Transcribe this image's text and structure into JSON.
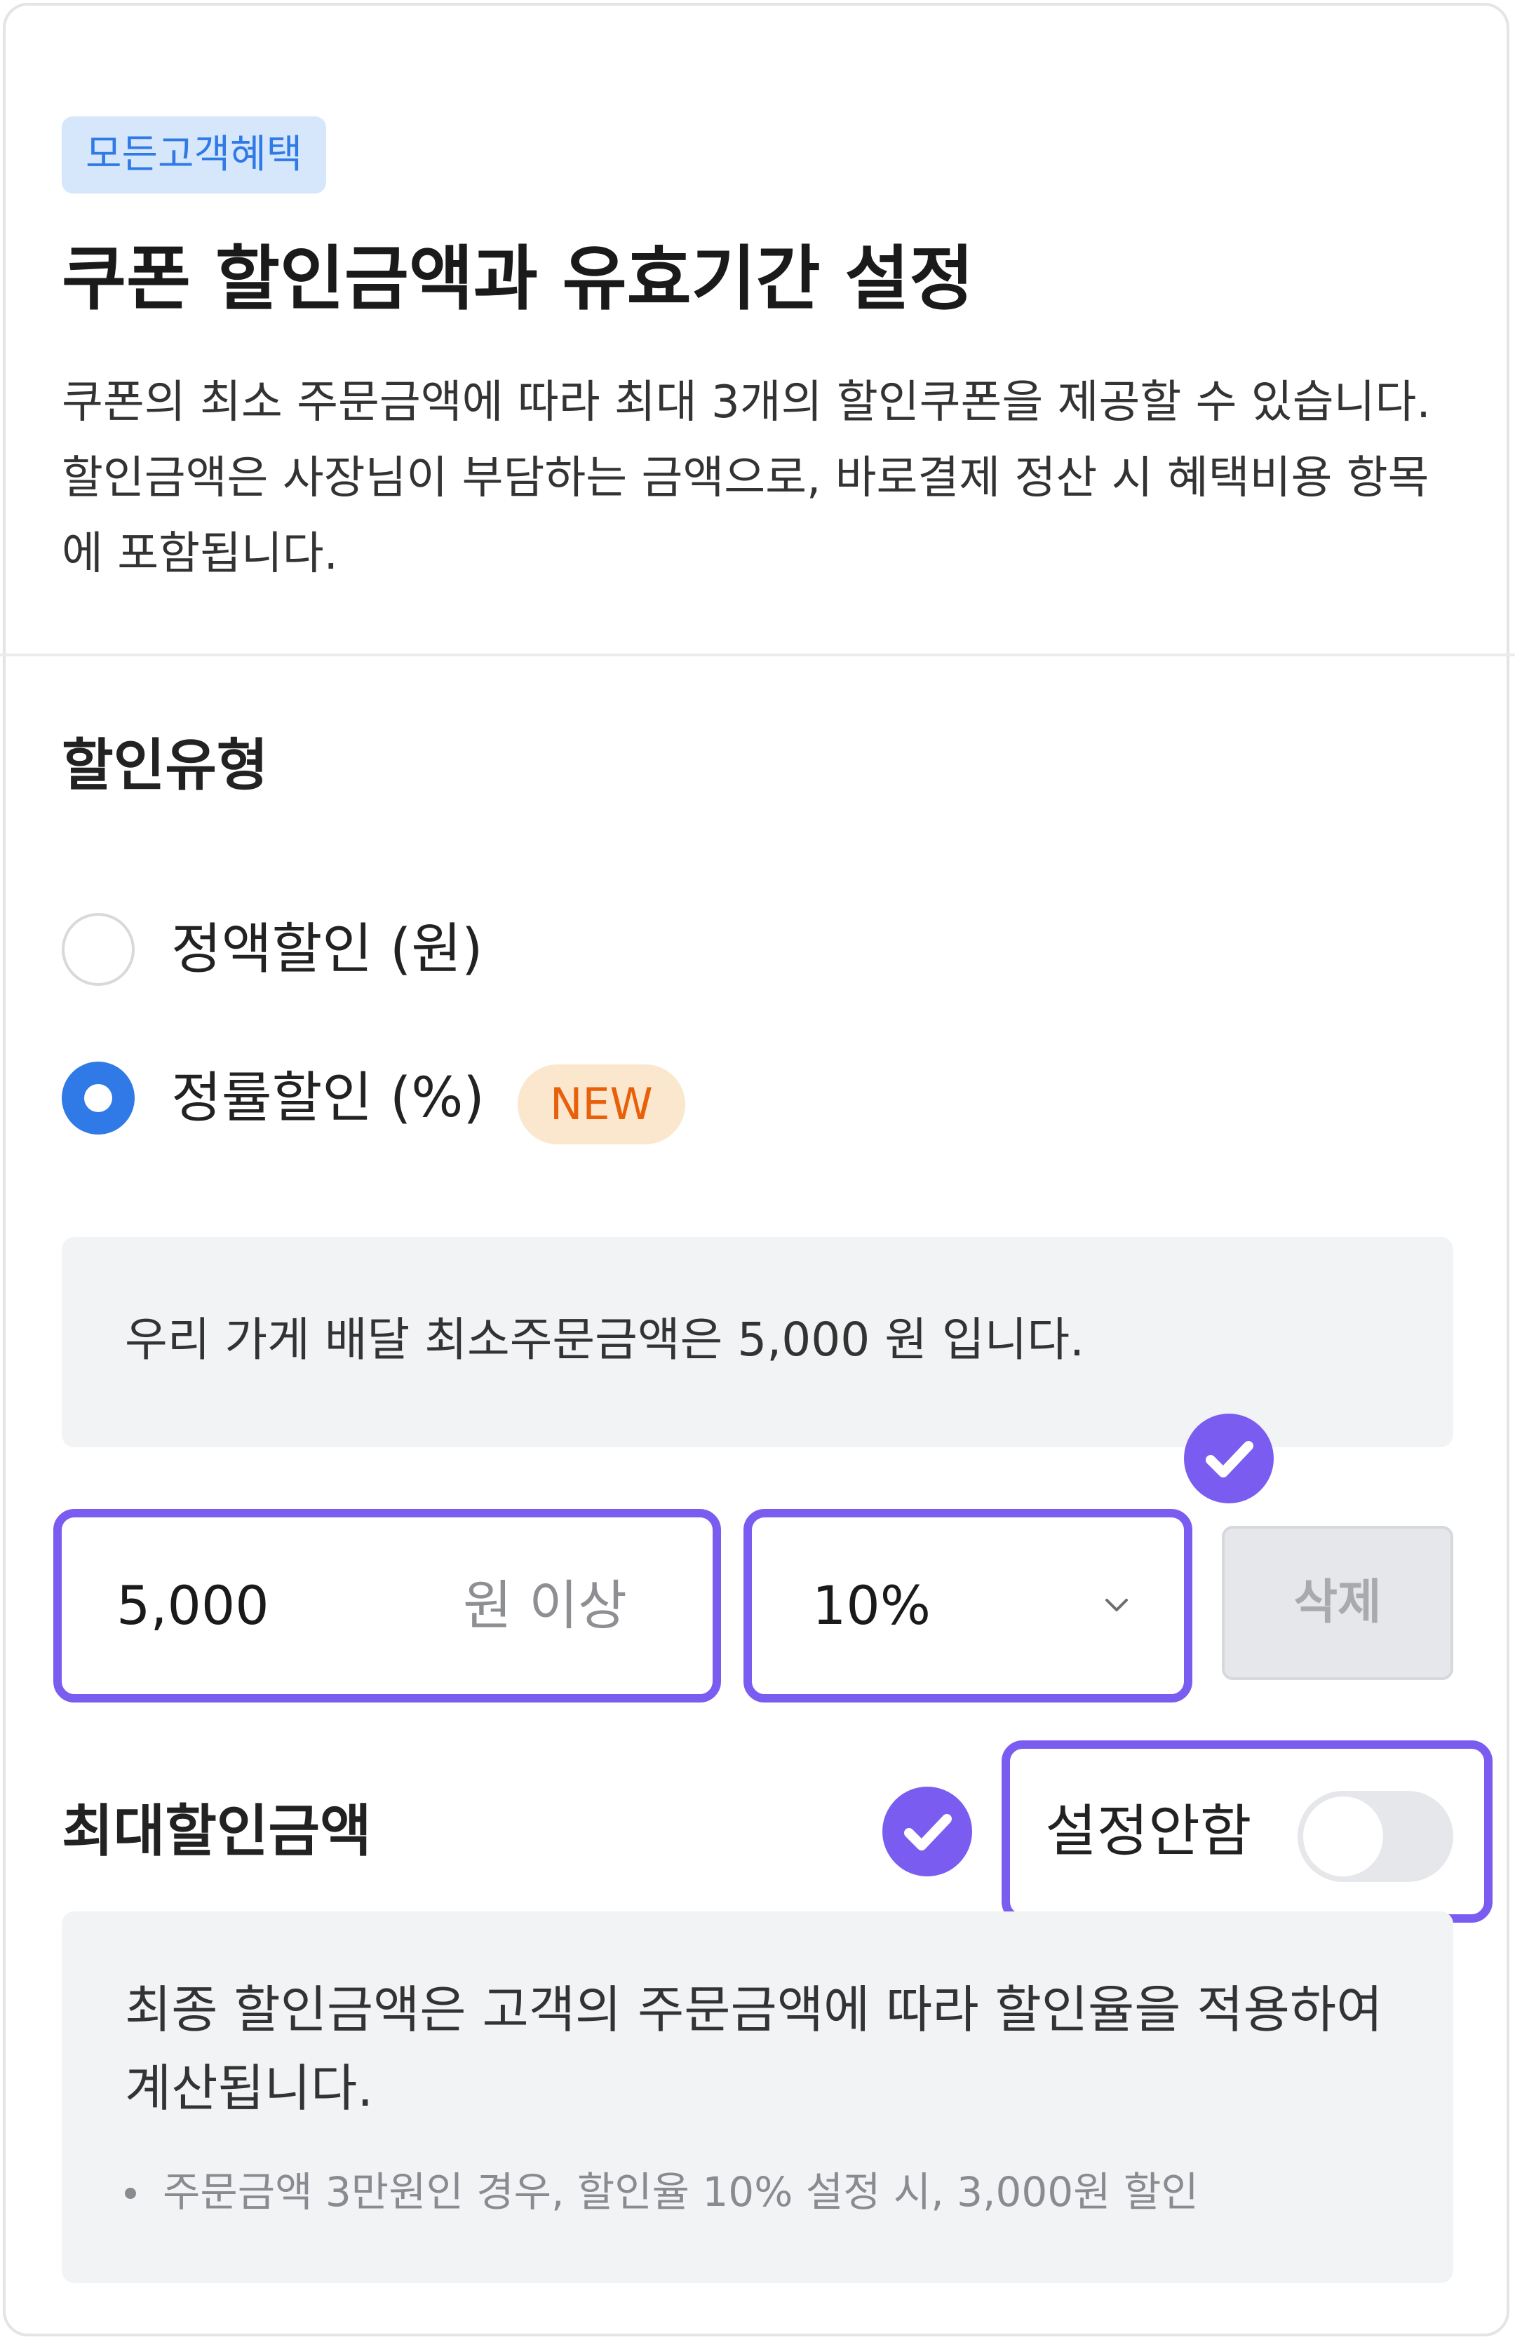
{
  "header": {
    "badge": "모든고객혜택",
    "title": "쿠폰 할인금액과 유효기간 설정",
    "description": "쿠폰의 최소 주문금액에 따라 최대 3개의 할인쿠폰을 제공할 수 있습니다. 할인금액은 사장님이 부담하는 금액으로, 바로결제 정산 시 혜택비용 항목에 포함됩니다."
  },
  "discount_type": {
    "label": "할인유형",
    "options": [
      {
        "label": "정액할인 (원)",
        "selected": false
      },
      {
        "label": "정률할인 (%)",
        "selected": true,
        "badge": "NEW"
      }
    ]
  },
  "min_order_info": "우리 가게 배달 최소주문금액은 5,000 원 입니다.",
  "coupon_row": {
    "min_amount_value": "5,000",
    "min_amount_suffix": "원 이상",
    "rate_value": "10%",
    "delete_label": "삭제"
  },
  "max_discount": {
    "label": "최대할인금액",
    "toggle_label": "설정안함",
    "toggle_on": false
  },
  "note": {
    "text": "최종 할인금액은 고객의 주문금액에 따라 할인율을 적용하여 계산됩니다.",
    "bullet": "주문금액 3만원인 경우, 할인율 10% 설정 시, 3,000원 할인"
  },
  "colors": {
    "accent_blue": "#2f7ae6",
    "highlight_purple": "#7b5cf0",
    "new_badge_orange": "#e8600a"
  },
  "icons": [
    "check-icon",
    "chevron-down-icon"
  ]
}
